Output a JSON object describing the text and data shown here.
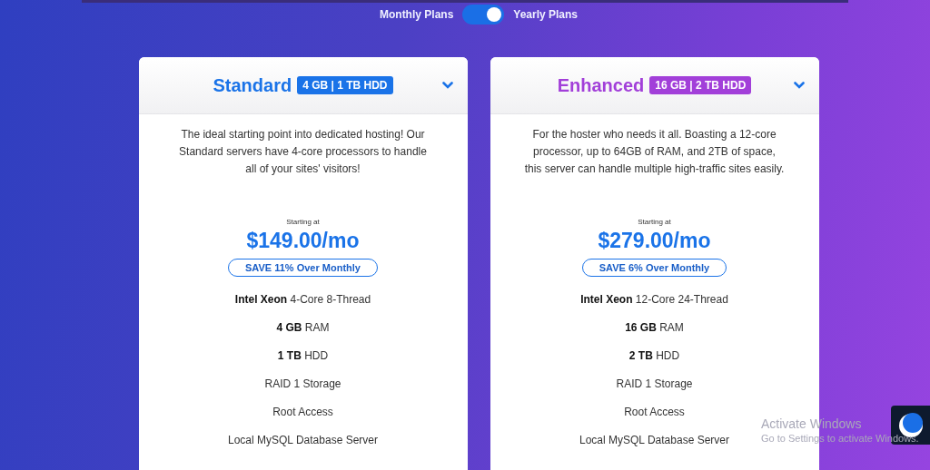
{
  "billing_toggle": {
    "left_label": "Monthly Plans",
    "right_label": "Yearly Plans",
    "on": true
  },
  "plans": [
    {
      "name": "Standard",
      "badge": "4 GB | 1 TB HDD",
      "color": "#1a73e8",
      "expanded": false,
      "description": "The ideal starting point into dedicated hosting! Our Standard servers have 4-core processors to handle all of your sites' visitors!",
      "price_caption": "Starting at",
      "price": "$149.00/mo",
      "savings": "SAVE 11% Over Monthly",
      "features": [
        "**Intel Xeon** 4-Core 8-Thread",
        "**4 GB** RAM",
        "**1 TB** HDD",
        "RAID 1 Storage",
        "Root Access",
        "Local MySQL Database Server"
      ]
    },
    {
      "name": "Enhanced",
      "badge": "16 GB | 2 TB HDD",
      "color": "#a23fd9",
      "expanded": false,
      "description": "For the hoster who needs it all. Boasting a 12-core processor, up to 64GB of RAM, and 2TB of space, this server can handle multiple high-traffic sites easily.",
      "price_caption": "Starting at",
      "price": "$279.00/mo",
      "savings": "SAVE 6% Over Monthly",
      "features": [
        "**Intel Xeon** 12-Core 24-Thread",
        "**16 GB** RAM",
        "**2 TB** HDD",
        "RAID 1 Storage",
        "Root Access",
        "Local MySQL Database Server"
      ]
    }
  ],
  "os_notice": {
    "title": "Activate Windows",
    "subtitle": "Go to Settings to activate Windows."
  }
}
